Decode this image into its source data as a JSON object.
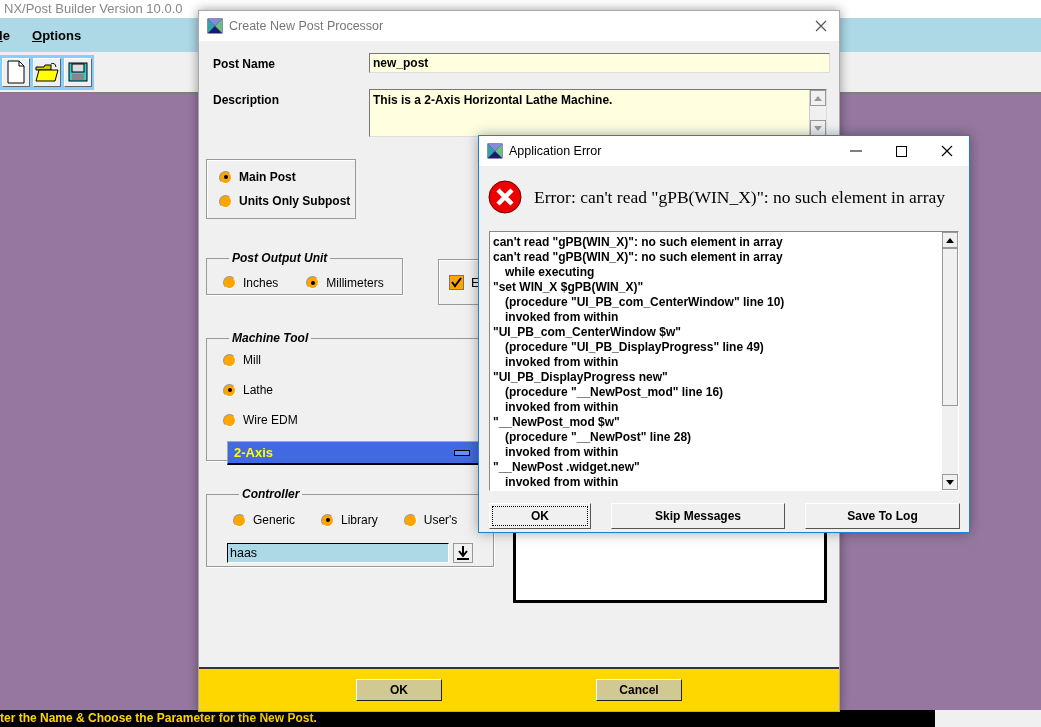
{
  "app": {
    "title": "NX/Post Builder Version 10.0.0",
    "menu": [
      {
        "label": "le"
      },
      {
        "label": "Options"
      }
    ],
    "status_bar": "ter the Name & Choose the Parameter for the New Post."
  },
  "new_post_dialog": {
    "title": "Create New Post Processor",
    "post_name": {
      "label": "Post Name",
      "value": "new_post"
    },
    "description": {
      "label": "Description",
      "value": "This is a 2-Axis Horizontal Lathe Machine."
    },
    "post_type": [
      {
        "label": "Main Post",
        "selected": true
      },
      {
        "label": "Units Only Subpost",
        "selected": false
      }
    ],
    "output_unit": {
      "title": "Post Output Unit",
      "options": [
        {
          "label": "Inches",
          "selected": false
        },
        {
          "label": "Millimeters",
          "selected": true
        }
      ]
    },
    "option_checkbox": {
      "label": "E",
      "checked": true
    },
    "machine_tool": {
      "title": "Machine Tool",
      "options": [
        {
          "label": "Mill",
          "selected": false
        },
        {
          "label": "Lathe",
          "selected": true
        },
        {
          "label": "Wire EDM",
          "selected": false
        }
      ],
      "axis": "2-Axis"
    },
    "controller": {
      "title": "Controller",
      "options": [
        {
          "label": "Generic",
          "selected": false
        },
        {
          "label": "Library",
          "selected": true
        },
        {
          "label": "User's",
          "selected": false
        }
      ],
      "value": "haas"
    },
    "buttons": [
      "OK",
      "Cancel"
    ]
  },
  "error_dialog": {
    "title": "Application Error",
    "message": "Error: can't read \"gPB(WIN_X)\": no such element in array",
    "log": [
      {
        "kind": "line",
        "text": "can't read \"gPB(WIN_X)\": no such element in array"
      },
      {
        "kind": "line",
        "text": "can't read \"gPB(WIN_X)\": no such element in array"
      },
      {
        "kind": "detail",
        "text": "while executing"
      },
      {
        "kind": "line",
        "text": "\"set WIN_X $gPB(WIN_X)\""
      },
      {
        "kind": "detail",
        "text": "(procedure \"UI_PB_com_CenterWindow\" line 10)"
      },
      {
        "kind": "detail",
        "text": "invoked from within"
      },
      {
        "kind": "line",
        "text": "\"UI_PB_com_CenterWindow $w\""
      },
      {
        "kind": "detail",
        "text": "(procedure \"UI_PB_DisplayProgress\" line 49)"
      },
      {
        "kind": "detail",
        "text": "invoked from within"
      },
      {
        "kind": "line",
        "text": "\"UI_PB_DisplayProgress new\""
      },
      {
        "kind": "detail",
        "text": "(procedure \"__NewPost_mod\" line 16)"
      },
      {
        "kind": "detail",
        "text": "invoked from within"
      },
      {
        "kind": "line",
        "text": "\"__NewPost_mod $w\""
      },
      {
        "kind": "detail",
        "text": "(procedure \"__NewPost\" line 28)"
      },
      {
        "kind": "detail",
        "text": "invoked from within"
      },
      {
        "kind": "line",
        "text": "\"__NewPost .widget.new\""
      },
      {
        "kind": "detail",
        "text": "invoked from within"
      }
    ],
    "buttons": [
      {
        "label": "OK",
        "focused": true
      },
      {
        "label": "Skip Messages",
        "focused": false
      },
      {
        "label": "Save To Log",
        "focused": false
      }
    ]
  }
}
